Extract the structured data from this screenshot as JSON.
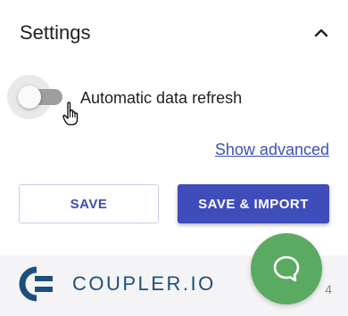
{
  "settings": {
    "title": "Settings",
    "collapse_icon": "chevron-up-icon"
  },
  "auto_refresh": {
    "label": "Automatic data refresh",
    "enabled": false
  },
  "show_advanced_label": "Show advanced",
  "buttons": {
    "save": "SAVE",
    "save_import": "SAVE & IMPORT"
  },
  "footer": {
    "logo_text": "COUPLER",
    "logo_suffix": ".IO",
    "version": "4"
  },
  "colors": {
    "primary": "#3f4dbb",
    "link": "#3f51b5",
    "brand": "#1d4f7c",
    "chat": "#5aaa62"
  }
}
